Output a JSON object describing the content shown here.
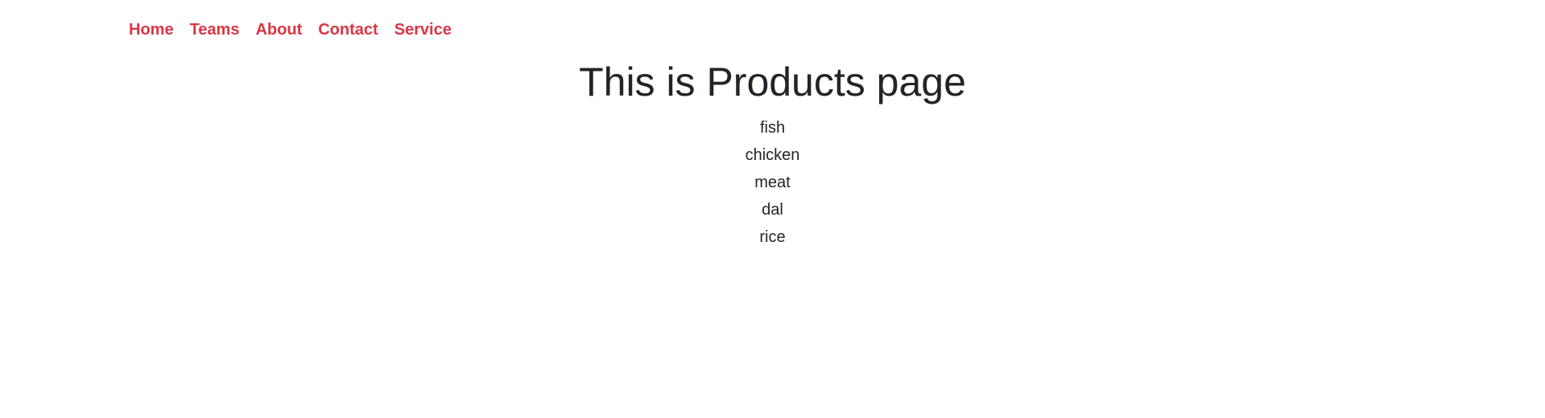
{
  "nav": {
    "items": [
      {
        "label": "Home"
      },
      {
        "label": "Teams"
      },
      {
        "label": "About"
      },
      {
        "label": "Contact"
      },
      {
        "label": "Service"
      }
    ],
    "color": "#dc3545"
  },
  "main": {
    "title": "This is Products page",
    "products": [
      "fish",
      "chicken",
      "meat",
      "dal",
      "rice"
    ]
  },
  "colors": {
    "text": "#212529",
    "background": "#ffffff"
  }
}
